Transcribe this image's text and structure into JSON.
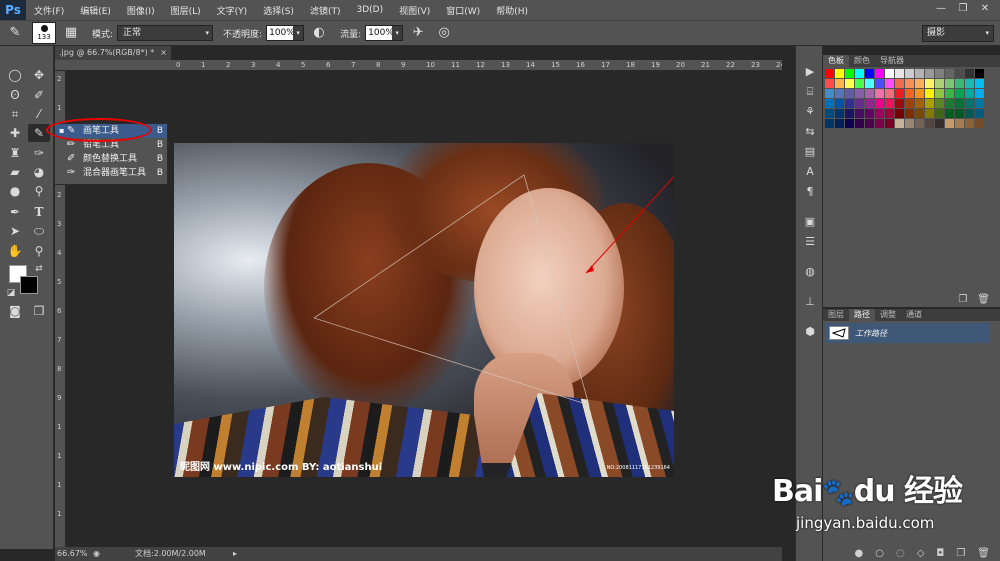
{
  "app": {
    "logo": "Ps"
  },
  "menu": [
    "文件(F)",
    "编辑(E)",
    "图像(I)",
    "图层(L)",
    "文字(Y)",
    "选择(S)",
    "滤镜(T)",
    "3D(D)",
    "视图(V)",
    "窗口(W)",
    "帮助(H)"
  ],
  "window_controls": [
    "—",
    "❐",
    "✕"
  ],
  "options": {
    "brush_size": "133",
    "mode_label": "模式:",
    "mode_value": "正常",
    "opacity_label": "不透明度:",
    "opacity_value": "100%",
    "flow_label": "流量:",
    "flow_value": "100%",
    "workspace": "摄影"
  },
  "document": {
    "tab_title": ".jpg @ 66.7%(RGB/8*) *",
    "zoom": "66.67%",
    "doc_info": "文档:2.00M/2.00M",
    "ruler_h": [
      "0",
      "1",
      "2",
      "3",
      "4",
      "5",
      "6",
      "7",
      "8",
      "9",
      "10",
      "11",
      "12",
      "13",
      "14",
      "15",
      "16",
      "17",
      "18",
      "19",
      "20",
      "21",
      "22",
      "23",
      "24",
      "25"
    ],
    "ruler_v": [
      "2",
      "1",
      "0",
      "1",
      "2",
      "3",
      "4",
      "5",
      "6",
      "7",
      "8",
      "9",
      "1",
      "1",
      "1",
      "1"
    ]
  },
  "flyout": [
    {
      "label": "画笔工具",
      "key": "B",
      "selected": true
    },
    {
      "label": "铅笔工具",
      "key": "B",
      "selected": false
    },
    {
      "label": "颜色替换工具",
      "key": "B",
      "selected": false
    },
    {
      "label": "混合器画笔工具",
      "key": "B",
      "selected": false
    }
  ],
  "photo": {
    "watermark_left": "昵图网 www.nipic.com   BY: aotianshui",
    "watermark_right": "NO:20081117151239164"
  },
  "panels": {
    "top_tabs": [
      "色板",
      "颜色",
      "导航器"
    ],
    "bottom_tabs": [
      "图层",
      "路径",
      "调整",
      "通道"
    ],
    "path_name": "工作路径"
  },
  "colors": {
    "swatches": [
      "#ff0000",
      "#ffff00",
      "#00ff00",
      "#00ffff",
      "#0000ff",
      "#ff00ff",
      "#ffffff",
      "#e6e6e6",
      "#cccccc",
      "#b3b3b3",
      "#999999",
      "#808080",
      "#666666",
      "#4d4d4d",
      "#333333",
      "#000000",
      "#ff4d4d",
      "#ffb34d",
      "#ffff4d",
      "#4dff4d",
      "#4dffff",
      "#4d4dff",
      "#ff4dff",
      "#f26c4f",
      "#f68e55",
      "#fbaf5c",
      "#fff467",
      "#acd372",
      "#7cc576",
      "#3bb878",
      "#1abbb4",
      "#00bff3",
      "#438ccb",
      "#5574b9",
      "#605ca8",
      "#855fa8",
      "#a763a8",
      "#f06ea9",
      "#f26d7d",
      "#ed1c24",
      "#f26522",
      "#f7941d",
      "#fff200",
      "#8dc63f",
      "#39b54a",
      "#00a651",
      "#00a99d",
      "#00aeef",
      "#0072bc",
      "#0054a6",
      "#2e3192",
      "#662d91",
      "#92278f",
      "#ec008c",
      "#ed145b",
      "#9e0b0f",
      "#a0410d",
      "#a36209",
      "#aba000",
      "#598527",
      "#1a7b30",
      "#007236",
      "#00746b",
      "#0076a3",
      "#004b80",
      "#003471",
      "#1b1464",
      "#440e62",
      "#630460",
      "#9e005d",
      "#9e0039",
      "#790000",
      "#7b2e00",
      "#7d4900",
      "#827b00",
      "#406618",
      "#005e20",
      "#005826",
      "#005952",
      "#005b7f",
      "#003663",
      "#002157",
      "#0d004c",
      "#32004b",
      "#4b0049",
      "#7b0046",
      "#7a0026",
      "#c7b299",
      "#998675",
      "#736357",
      "#534741",
      "#362f2d",
      "#c69c6d",
      "#a67c52",
      "#8c6239",
      "#754c24"
    ],
    "accent": "#3a5b8c",
    "annotation": "#e00000"
  }
}
